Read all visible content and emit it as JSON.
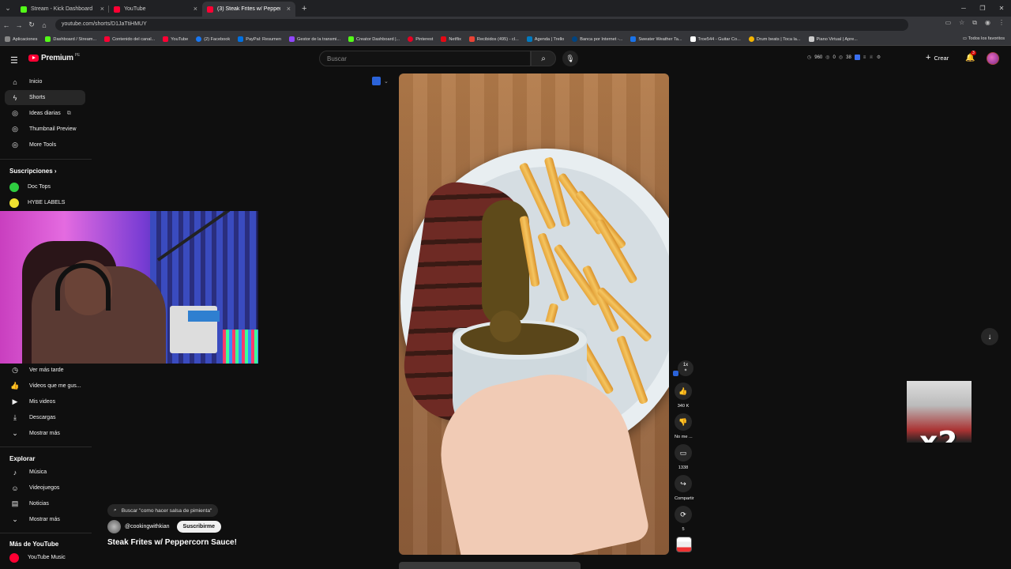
{
  "browser": {
    "tabs": [
      {
        "label": "Stream - Kick Dashboard",
        "color": "#53fc18"
      },
      {
        "label": "YouTube",
        "color": "#ff0033"
      },
      {
        "label": "(3) Steak Frites w/ Peppercorn Sauce!",
        "color": "#ff0033"
      }
    ],
    "url": "youtube.com/shorts/D1JaTtiHMUY",
    "bookmarks": [
      {
        "label": "Aplicaciones",
        "color": "#888"
      },
      {
        "label": "Dashboard / Stream...",
        "color": "#53fc18"
      },
      {
        "label": "Contenido del canal...",
        "color": "#ff0033"
      },
      {
        "label": "YouTube",
        "color": "#ff0033"
      },
      {
        "label": "(2) Facebook",
        "color": "#1877f2"
      },
      {
        "label": "PayPal: Resumen",
        "color": "#0070e0"
      },
      {
        "label": "Gestor de la transmi...",
        "color": "#9146ff"
      },
      {
        "label": "Creator Dashboard |...",
        "color": "#53fc18"
      },
      {
        "label": "Pinterest",
        "color": "#e60023"
      },
      {
        "label": "Netflix",
        "color": "#e50914"
      },
      {
        "label": "Recibidos (495) - cl...",
        "color": "#ea4335"
      },
      {
        "label": "Agenda | Trello",
        "color": "#0079bf"
      },
      {
        "label": "Banca por Internet -...",
        "color": "#004481"
      },
      {
        "label": "Sweater Weather Ta...",
        "color": "#1a73e8"
      },
      {
        "label": "Troe544 - Guitar Co...",
        "color": "#ffffff"
      },
      {
        "label": "Drum beats | Toca la...",
        "color": "#f4b400"
      },
      {
        "label": "Piano Virtual | Apre...",
        "color": "#cccccc"
      }
    ],
    "bookmarks_all": "Todos los favoritos"
  },
  "header": {
    "logo_text": "Premium",
    "region": "PE",
    "search_placeholder": "Buscar",
    "stats": [
      "960",
      "0",
      "38"
    ],
    "create_label": "Crear",
    "notif_count": "3"
  },
  "sidebar": {
    "top_items": [
      {
        "label": "Inicio",
        "icon": "home-icon",
        "glyph": "⌂"
      },
      {
        "label": "Shorts",
        "icon": "shorts-icon",
        "glyph": "⚡"
      },
      {
        "label": "Ideas diarias",
        "icon": "ideas-icon",
        "glyph": "◎"
      },
      {
        "label": "Thumbnail Preview",
        "icon": "preview-icon",
        "glyph": "◎"
      },
      {
        "label": "More Tools",
        "icon": "tools-icon",
        "glyph": "◎"
      }
    ],
    "subs_title": "Suscripciones",
    "subs": [
      {
        "label": "Doc Tops",
        "color": "#2ecc40"
      },
      {
        "label": "HYBE LABELS",
        "color": "#f0e130"
      }
    ],
    "you_items": [
      {
        "label": "Ver más tarde",
        "glyph": "◷"
      },
      {
        "label": "Videos que me gus...",
        "glyph": "👍"
      },
      {
        "label": "Mis videos",
        "glyph": "▶"
      },
      {
        "label": "Descargas",
        "glyph": "⤓"
      },
      {
        "label": "Mostrar más",
        "glyph": "⌄"
      }
    ],
    "explore_title": "Explorar",
    "explore_items": [
      {
        "label": "Música",
        "glyph": "♪"
      },
      {
        "label": "Videojuegos",
        "glyph": "🎮"
      },
      {
        "label": "Noticias",
        "glyph": "▤"
      },
      {
        "label": "Mostrar más",
        "glyph": "⌄"
      }
    ],
    "more_title": "Más de YouTube",
    "more_items": [
      {
        "label": "YouTube Music",
        "color": "#ff0033"
      }
    ]
  },
  "short": {
    "search_chip": "Buscar \"como hacer salsa de pimienta\"",
    "channel": "@cookingwithkian",
    "subscribe": "Suscribirme",
    "title": "Steak Frites w/ Peppercorn Sauce!",
    "speed": "1x",
    "likes": "340 K",
    "dislike_label": "No me ...",
    "comments": "1338",
    "share_label": "Compartir",
    "remix_count": "5"
  },
  "overlay": {
    "multiplier": "x2"
  }
}
